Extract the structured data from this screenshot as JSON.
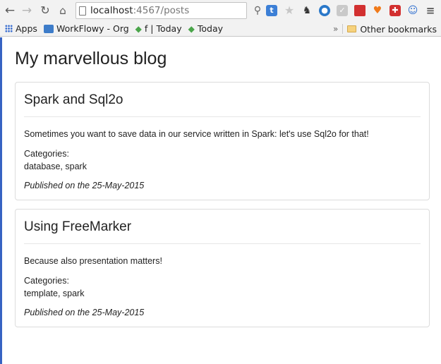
{
  "browser": {
    "url_host": "localhost",
    "url_path": ":4567/posts",
    "bookmarks": {
      "apps": "Apps",
      "workflowy": "WorkFlowy - Org",
      "f_today": "f | Today",
      "today": "Today",
      "other": "Other bookmarks"
    }
  },
  "page": {
    "title": "My marvellous blog"
  },
  "posts": [
    {
      "title": "Spark and Sql2o",
      "body": "Sometimes you want to save data in our service written in Spark: let's use Sql2o for that!",
      "categories_label": "Categories:",
      "categories": "database, spark",
      "published": "Published on the 25-May-2015"
    },
    {
      "title": "Using FreeMarker",
      "body": "Because also presentation matters!",
      "categories_label": "Categories:",
      "categories": "template, spark",
      "published": "Published on the 25-May-2015"
    }
  ]
}
